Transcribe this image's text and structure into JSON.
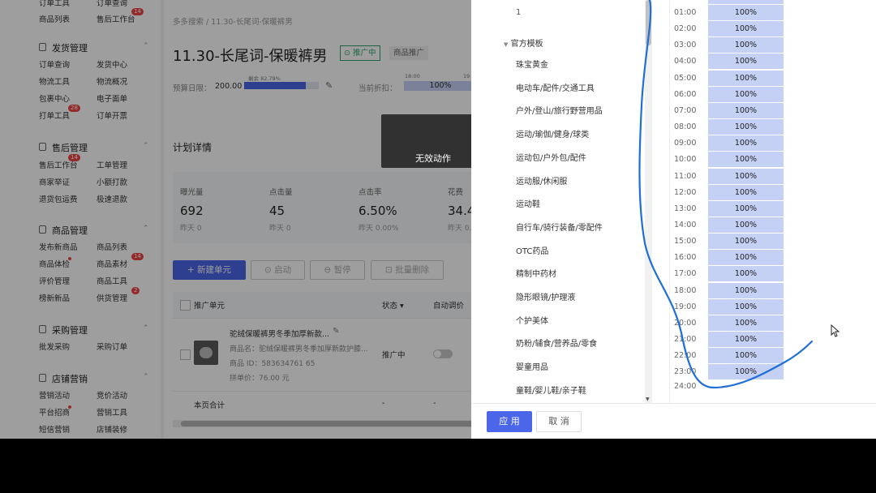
{
  "sidebar": {
    "rows": [
      {
        "a": "订单工具",
        "b": "订单查询"
      },
      {
        "a": "商品列表",
        "b": "售后工作台",
        "badge_b": "14"
      },
      {
        "section": "发货管理"
      },
      {
        "a": "订单查询",
        "b": "发货中心"
      },
      {
        "a": "物流工具",
        "b": "物流概况"
      },
      {
        "a": "包裹中心",
        "b": "电子面单"
      },
      {
        "a": "打单工具",
        "badge_a": "28",
        "b": "订单开票"
      },
      {
        "section": "售后管理"
      },
      {
        "a": "售后工作台",
        "badge_a": "14",
        "b": "工单管理"
      },
      {
        "a": "商家举证",
        "b": "小额打款"
      },
      {
        "a": "退货包运费",
        "b": "极速退款"
      },
      {
        "section": "商品管理"
      },
      {
        "a": "发布新商品",
        "b": "商品列表"
      },
      {
        "a": "商品体检",
        "b": "商品素材",
        "badge_b": "14"
      },
      {
        "a": "评价管理",
        "b": "商品工具"
      },
      {
        "a": "榜新新品",
        "b": "供货管理",
        "badge_b": "2"
      },
      {
        "section": "采购管理"
      },
      {
        "a": "批发采购",
        "b": "采购订单"
      },
      {
        "section": "店铺营销"
      },
      {
        "a": "营销活动",
        "b": "竞价活动"
      },
      {
        "a": "平台招商",
        "b": "营销工具"
      },
      {
        "a": "短信营销",
        "b": "店铺装修"
      }
    ]
  },
  "main": {
    "breadcrumb": "多多搜索 / 11.30-长尾词-保暖裤男",
    "title": "11.30-长尾词-保暖裤男",
    "status_tag": "推广中",
    "type_tag": "商品推广",
    "budget_label": "预算日限：",
    "budget_value": "200.00",
    "budget_used_caption": "剩余 82.79%",
    "budget_used_fraction": 0.83,
    "discount_label": "当前折扣：",
    "discount_time_a": "18:00",
    "discount_time_b": "19",
    "discount_value": "100%",
    "section_title": "计划详情",
    "stats": [
      {
        "label": "曝光量",
        "value": "692",
        "prev": "昨天 0"
      },
      {
        "label": "点击量",
        "value": "45",
        "prev": "昨天 0"
      },
      {
        "label": "点击率",
        "value": "6.50%",
        "prev": "昨天 0.00%"
      },
      {
        "label": "花费",
        "value": "34.4",
        "prev": "昨天 0."
      }
    ],
    "buttons": {
      "new_unit": "+ 新建单元",
      "start": "启动",
      "pause": "暂停",
      "batch_delete": "批量删除"
    },
    "table": {
      "col_unit": "推广单元",
      "col_status": "状态",
      "col_auto": "自动调价",
      "row": {
        "title": "驼绒保暖裤男冬季加厚新款...",
        "name": "商品名：驼绒保暖裤男冬季加厚新款护膝...",
        "id": "商品 ID：583634761 65",
        "price": "拼单价：76.00 元",
        "status": "推广中"
      },
      "total_label": "本页合计",
      "total_status": "-",
      "total_auto": "-"
    }
  },
  "toast": "无效动作",
  "panel": {
    "top_number": "1",
    "group_label": "官方模板",
    "categories": [
      "珠宝黄金",
      "电动车/配件/交通工具",
      "户外/登山/旅行野营用品",
      "运动/瑜伽/健身/球类",
      "运动包/户外包/配件",
      "运动服/休闲服",
      "运动鞋",
      "自行车/骑行装备/零配件",
      "OTC药品",
      "精制中药材",
      "隐形眼镜/护理液",
      "个护美体",
      "奶粉/辅食/营养品/零食",
      "婴童用品",
      "童鞋/婴儿鞋/亲子鞋"
    ],
    "time_rows": [
      {
        "t": "01:00",
        "v": "100%"
      },
      {
        "t": "02:00",
        "v": "100%"
      },
      {
        "t": "03:00",
        "v": "100%"
      },
      {
        "t": "04:00",
        "v": "100%"
      },
      {
        "t": "05:00",
        "v": "100%"
      },
      {
        "t": "06:00",
        "v": "100%"
      },
      {
        "t": "07:00",
        "v": "100%"
      },
      {
        "t": "08:00",
        "v": "100%"
      },
      {
        "t": "09:00",
        "v": "100%"
      },
      {
        "t": "10:00",
        "v": "100%"
      },
      {
        "t": "11:00",
        "v": "100%"
      },
      {
        "t": "12:00",
        "v": "100%"
      },
      {
        "t": "13:00",
        "v": "100%"
      },
      {
        "t": "14:00",
        "v": "100%"
      },
      {
        "t": "15:00",
        "v": "100%"
      },
      {
        "t": "16:00",
        "v": "100%"
      },
      {
        "t": "17:00",
        "v": "100%"
      },
      {
        "t": "18:00",
        "v": "100%"
      },
      {
        "t": "19:00",
        "v": "100%"
      },
      {
        "t": "20:00",
        "v": "100%"
      },
      {
        "t": "21:00",
        "v": "100%"
      },
      {
        "t": "22:00",
        "v": "100%"
      },
      {
        "t": "23:00",
        "v": "100%"
      }
    ],
    "end_time": "24:00",
    "apply_label": "应 用",
    "cancel_label": "取 消"
  },
  "colors": {
    "accent": "#4b66e8",
    "cell": "#c5d0f5",
    "annotation": "#1f6fd6",
    "badge": "#f04545"
  }
}
